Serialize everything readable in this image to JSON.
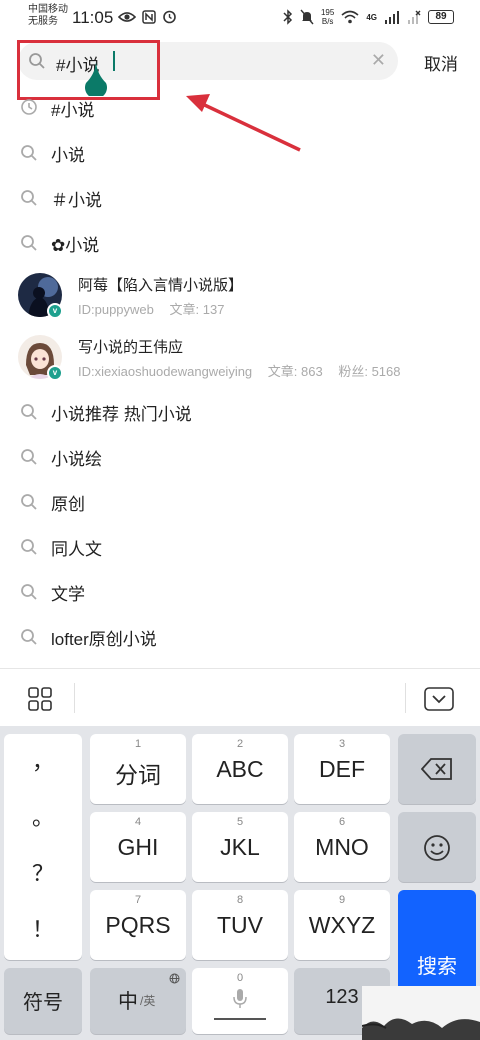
{
  "status_bar": {
    "carrier_line1": "中国移动",
    "carrier_line2": "无服务",
    "time": "11:05",
    "net_speed_value": "195",
    "net_speed_unit": "B/s",
    "network_label": "4G",
    "battery": "89"
  },
  "search": {
    "query": "#小说",
    "cancel_label": "取消"
  },
  "history": {
    "label": "#小说"
  },
  "suggestions_top": [
    {
      "label": "小说"
    },
    {
      "label": "＃小说"
    },
    {
      "label": "✿小说"
    }
  ],
  "users": [
    {
      "name": "阿莓【陷入言情小说版】",
      "id": "ID:puppyweb",
      "articles": "文章: 137",
      "fans": ""
    },
    {
      "name": "写小说的王伟应",
      "id": "ID:xiexiaoshuodewangweiying",
      "articles": "文章: 863",
      "fans": "粉丝: 5168"
    }
  ],
  "suggestions_bottom": [
    {
      "label": "小说推荐 热门小说"
    },
    {
      "label": "小说绘"
    },
    {
      "label": "原创"
    },
    {
      "label": "同人文"
    },
    {
      "label": "文学"
    },
    {
      "label": "lofter原创小说"
    }
  ],
  "keyboard": {
    "punctuation": [
      "，",
      "。",
      "？",
      "！"
    ],
    "keys": [
      {
        "num": "1",
        "label": "分词"
      },
      {
        "num": "2",
        "label": "ABC"
      },
      {
        "num": "3",
        "label": "DEF"
      },
      {
        "num": "4",
        "label": "GHI"
      },
      {
        "num": "5",
        "label": "JKL"
      },
      {
        "num": "6",
        "label": "MNO"
      },
      {
        "num": "7",
        "label": "PQRS"
      },
      {
        "num": "8",
        "label": "TUV"
      },
      {
        "num": "9",
        "label": "WXYZ"
      }
    ],
    "symbols_label": "符号",
    "lang_main": "中",
    "lang_alt": "/英",
    "space_num": "0",
    "num_label": "123",
    "search_label": "搜索"
  },
  "colors": {
    "accent_teal": "#0b7a68",
    "annotation_red": "#d9303c",
    "search_key_blue": "#1263ff"
  }
}
